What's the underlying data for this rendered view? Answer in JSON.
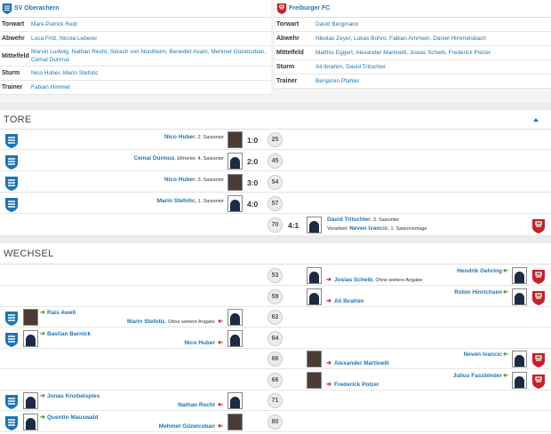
{
  "lineups": {
    "home": {
      "name": "SV Oberachern",
      "rows": [
        {
          "k": "Torwart",
          "v": "Mark-Patrick Redl"
        },
        {
          "k": "Abwehr",
          "v": "Luca Fritz, Nicola Leberer"
        },
        {
          "k": "Mittelfeld",
          "v": "Marvin Ludwig, Nathan Recht, Serach von Nordheim, Benedikt Asam, Mehmet Güzelcoban, Cemal Durmus"
        },
        {
          "k": "Sturm",
          "v": "Nico Huber, Marin Stefotic"
        },
        {
          "k": "Trainer",
          "v": "Fabian Himmel"
        }
      ]
    },
    "away": {
      "name": "Freiburger FC",
      "rows": [
        {
          "k": "Torwart",
          "v": "David Bergmann"
        },
        {
          "k": "Abwehr",
          "v": "Nikolas Zeyer, Lukas Bohro, Fabian Amrhein, Daniel Himmelsbach"
        },
        {
          "k": "Mittelfeld",
          "v": "Matthis Eggert, Alexander Martinelli, Josias Scheib, Frederick Polzer"
        },
        {
          "k": "Sturm",
          "v": "Ali Ibrahim, David Tritschler"
        },
        {
          "k": "Trainer",
          "v": "Benjamin Pfahler"
        }
      ]
    }
  },
  "goals_title": "TORE",
  "goals": [
    {
      "side": "home",
      "player": "Nico Huber",
      "info": ", 2. Saisontor",
      "score": "1:0",
      "minute": "25",
      "photo": "real"
    },
    {
      "side": "home",
      "player": "Cemal Durmus",
      "info": ", Elfmeter, 4. Saisontor",
      "score": "2:0",
      "minute": "45",
      "photo": "sil"
    },
    {
      "side": "home",
      "player": "Nico Huber",
      "info": ", 3. Saisontor",
      "score": "3:0",
      "minute": "54",
      "photo": "real"
    },
    {
      "side": "home",
      "player": "Marin Stefotic",
      "info": ", 1. Saisontor",
      "score": "4:0",
      "minute": "57",
      "photo": "sil"
    },
    {
      "side": "away",
      "player": "David Tritschler",
      "info": ", 3. Saisontor",
      "assist_label": "Vorarbeit:",
      "assist": "Neven Ivancic",
      "assist_info": ", 1. Saisonvorlage",
      "score": "4:1",
      "minute": "70",
      "photo": "sil"
    }
  ],
  "subs_title": "WECHSEL",
  "subs": [
    {
      "side": "away",
      "minute": "53",
      "in": "Hendrik Gehring",
      "out": "Josias Scheib",
      "out_info": ", Ohne weitere Angabe"
    },
    {
      "side": "away",
      "minute": "59",
      "in": "Robin Hinrichsen",
      "out": "Ali Ibrahim",
      "out_info": ""
    },
    {
      "side": "home",
      "minute": "62",
      "in": "Rais Awell",
      "out": "Marin Stefotic",
      "out_info": ", Ohne weitere Angabe"
    },
    {
      "side": "home",
      "minute": "64",
      "in": "Bastian Barnick",
      "out": "Nico Huber",
      "out_info": ""
    },
    {
      "side": "away",
      "minute": "66",
      "in": "Neven Ivancic",
      "out": "Alexander Martinelli",
      "out_info": ""
    },
    {
      "side": "away",
      "minute": "66",
      "in": "Julius Fassbinder",
      "out": "Frederick Polzer",
      "out_info": ""
    },
    {
      "side": "home",
      "minute": "71",
      "in": "Jonas Knobelspies",
      "out": "Nathan Recht",
      "out_info": ""
    },
    {
      "side": "home",
      "minute": "80",
      "in": "Quentin Mauswald",
      "out": "Mehmet Güzelcoban",
      "out_info": ""
    }
  ],
  "colors": {
    "link": "#1d75b3",
    "in": "#3a9a2c",
    "out": "#c0242a",
    "home_club": "#1d75b3",
    "away_club": "#c0242a"
  },
  "icons": {
    "home_logo": "sv-oberachern-crest",
    "away_logo": "freiburger-fc-crest",
    "collapse": "chevron-up-icon"
  }
}
